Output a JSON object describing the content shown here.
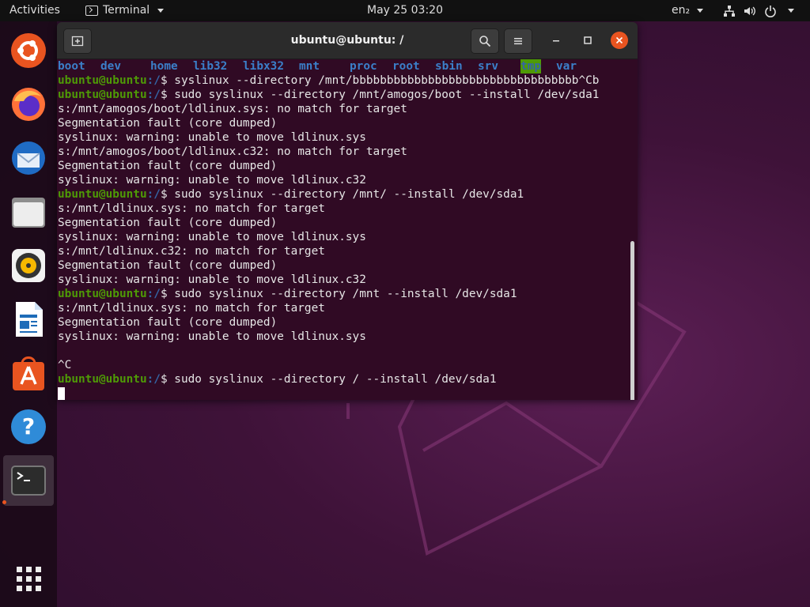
{
  "topbar": {
    "activities": "Activities",
    "app_name": "Terminal",
    "clock": "May 25  03:20",
    "language": "en₂"
  },
  "dock": {
    "items": [
      "ubuntu-installer-icon",
      "firefox-icon",
      "thunderbird-icon",
      "files-icon",
      "rhythmbox-icon",
      "libreoffice-writer-icon",
      "ubuntu-software-icon",
      "help-icon",
      "terminal-icon",
      "show-apps-icon"
    ]
  },
  "terminal": {
    "title": "ubuntu@ubuntu: /",
    "ls_dirs": [
      "boot",
      "dev",
      "home",
      "lib32",
      "libx32",
      "mnt",
      "proc",
      "root",
      "sbin",
      "srv",
      "tmp",
      "var"
    ],
    "prompt_user": "ubuntu@ubuntu",
    "prompt_path": ":/",
    "lines": [
      {
        "type": "cmd",
        "text": "$ syslinux --directory /mnt/bbbbbbbbbbbbbbbbbbbbbbbbbbbbbbbbb^Cb"
      },
      {
        "type": "cmd",
        "text": "$ sudo syslinux --directory /mnt/amogos/boot --install /dev/sda1"
      },
      {
        "type": "out",
        "text": "s:/mnt/amogos/boot/ldlinux.sys: no match for target"
      },
      {
        "type": "out",
        "text": "Segmentation fault (core dumped)"
      },
      {
        "type": "out",
        "text": "syslinux: warning: unable to move ldlinux.sys"
      },
      {
        "type": "out",
        "text": "s:/mnt/amogos/boot/ldlinux.c32: no match for target"
      },
      {
        "type": "out",
        "text": "Segmentation fault (core dumped)"
      },
      {
        "type": "out",
        "text": "syslinux: warning: unable to move ldlinux.c32"
      },
      {
        "type": "cmd",
        "text": "$ sudo syslinux --directory /mnt/ --install /dev/sda1"
      },
      {
        "type": "out",
        "text": "s:/mnt/ldlinux.sys: no match for target"
      },
      {
        "type": "out",
        "text": "Segmentation fault (core dumped)"
      },
      {
        "type": "out",
        "text": "syslinux: warning: unable to move ldlinux.sys"
      },
      {
        "type": "out",
        "text": "s:/mnt/ldlinux.c32: no match for target"
      },
      {
        "type": "out",
        "text": "Segmentation fault (core dumped)"
      },
      {
        "type": "out",
        "text": "syslinux: warning: unable to move ldlinux.c32"
      },
      {
        "type": "cmd",
        "text": "$ sudo syslinux --directory /mnt --install /dev/sda1"
      },
      {
        "type": "out",
        "text": "s:/mnt/ldlinux.sys: no match for target"
      },
      {
        "type": "out",
        "text": "Segmentation fault (core dumped)"
      },
      {
        "type": "out",
        "text": "syslinux: warning: unable to move ldlinux.sys"
      },
      {
        "type": "out",
        "text": ""
      },
      {
        "type": "out",
        "text": "^C"
      },
      {
        "type": "cmd",
        "text": "$ sudo syslinux --directory / --install /dev/sda1"
      }
    ]
  }
}
